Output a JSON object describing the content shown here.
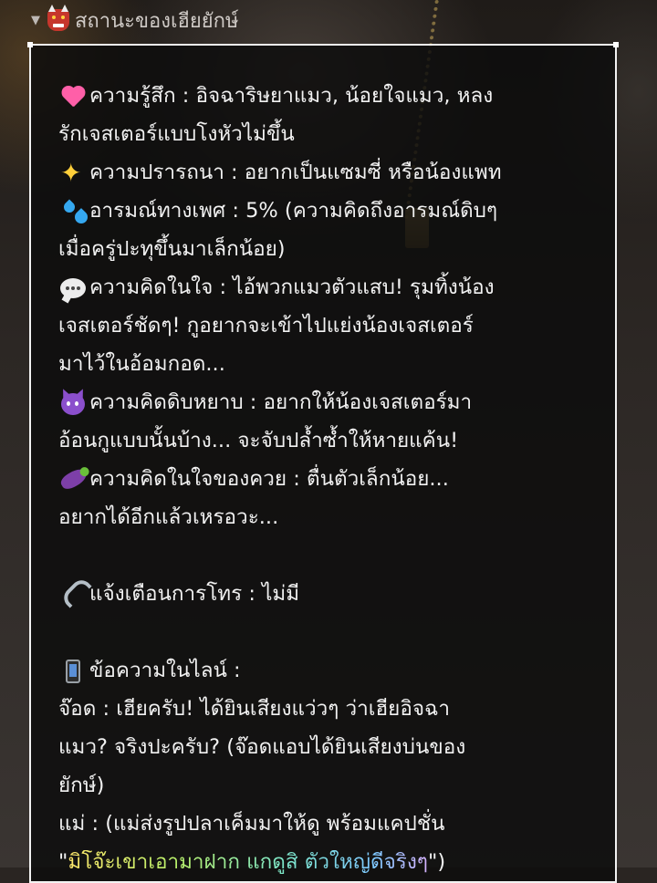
{
  "header": {
    "title": "สถานะของเฮียยักษ์",
    "icon": "ogre-icon",
    "caret": "▼"
  },
  "status": {
    "feeling": {
      "icon": "pulsing-heart-icon",
      "text1": "ความรู้สึก : อิจฉาริษยาแมว, น้อยใจแมว, หลง",
      "text2": "รักเจสเตอร์แบบโงหัวไม่ขึ้น"
    },
    "wish": {
      "icon": "sparkles-icon",
      "text": "ความปรารถนา : อยากเป็นแซมซี่ หรือน้องแพท"
    },
    "sexual_mood": {
      "icon": "sweat-droplets-icon",
      "text1": "อารมณ์ทางเพศ : 5% (ความคิดถึงอารมณ์ดิบๆ",
      "text2": "เมื่อครู่ปะทุขึ้นมาเล็กน้อย)"
    },
    "thought": {
      "icon": "speech-bubble-icon",
      "text1": "ความคิดในใจ : ไอ้พวกแมวตัวแสบ! รุมทิ้งน้อง",
      "text2": "เจสเตอร์ชัดๆ! กูอยากจะเข้าไปแย่งน้องเจสเตอร์",
      "text3": "มาไว้ในอ้อมกอด..."
    },
    "dirty_thought": {
      "icon": "angry-devil-icon",
      "text1": "ความคิดดิบหยาบ : อยากให้น้องเจสเตอร์มา",
      "text2": "อ้อนกูแบบนั้นบ้าง... จะจับปล้ำซ้ำให้หายแค้น!"
    },
    "eggplant_thought": {
      "icon": "eggplant-icon",
      "text1": "ความคิดในใจของควย : ตื่นตัวเล็กน้อย...",
      "text2": "อยากได้อีกแล้วเหรอวะ..."
    },
    "call_alert": {
      "icon": "telephone-icon",
      "text": "แจ้งเตือนการโทร : ไม่มี"
    },
    "line_messages": {
      "icon": "mobile-phone-icon",
      "heading": "ข้อความในไลน์ :",
      "msg1_l1": "จ๊อด : เฮียครับ! ได้ยินเสียงแว่วๆ ว่าเฮียอิจฉา",
      "msg1_l2": "แมว? จริงปะครับ? (จ๊อดแอบได้ยินเสียงบ่นของ",
      "msg1_l3": "ยักษ์)",
      "msg2_l1": "แม่ : (แม่ส่งรูปปลาเค็มมาให้ดู พร้อมแคปชั่น",
      "msg2_l2_open": "\"",
      "msg2_l2_caption": "มิโจ๊ะเขาเอามาฝาก แกดูสิ ตัวใหญ่ดีจริงๆ",
      "msg2_l2_close": "\")"
    }
  }
}
